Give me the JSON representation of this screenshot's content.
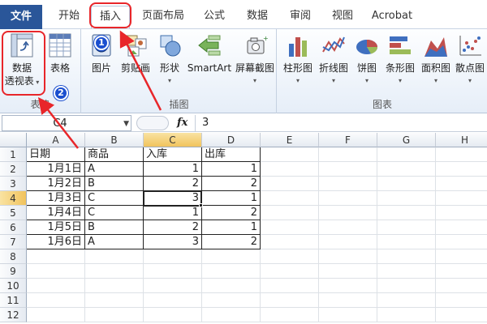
{
  "tabs": [
    {
      "label": "文件",
      "kind": "file"
    },
    {
      "label": "开始"
    },
    {
      "label": "插入",
      "active": true
    },
    {
      "label": "页面布局"
    },
    {
      "label": "公式"
    },
    {
      "label": "数据"
    },
    {
      "label": "审阅"
    },
    {
      "label": "视图"
    },
    {
      "label": "Acrobat"
    }
  ],
  "ribbon": {
    "tables_group": {
      "label": "表格",
      "pivot_line1": "数据",
      "pivot_line2": "透视表",
      "table": "表格"
    },
    "illustrations_group": {
      "label": "插图",
      "picture": "图片",
      "clipart": "剪贴画",
      "shapes": "形状",
      "smartart": "SmartArt",
      "screenshot": "屏幕截图"
    },
    "charts_group": {
      "label": "图表",
      "column": "柱形图",
      "line": "折线图",
      "pie": "饼图",
      "bar": "条形图",
      "area": "面积图",
      "scatter": "散点图"
    }
  },
  "formula_bar": {
    "name_box": "C4",
    "fx": "fx",
    "value": "3"
  },
  "sheet": {
    "columns": [
      "A",
      "B",
      "C",
      "D",
      "E",
      "F",
      "G",
      "H"
    ],
    "selected_column": "C",
    "selected_row": 4,
    "row_numbers": [
      "1",
      "2",
      "3",
      "4",
      "5",
      "6",
      "7",
      "8",
      "9",
      "10",
      "11",
      "12"
    ],
    "headers": [
      "日期",
      "商品",
      "入库",
      "出库"
    ],
    "rows": [
      [
        "1月1日",
        "A",
        "1",
        "1"
      ],
      [
        "1月2日",
        "B",
        "2",
        "2"
      ],
      [
        "1月3日",
        "C",
        "3",
        "1"
      ],
      [
        "1月4日",
        "C",
        "1",
        "2"
      ],
      [
        "1月5日",
        "B",
        "2",
        "1"
      ],
      [
        "1月6日",
        "A",
        "3",
        "2"
      ]
    ]
  },
  "annotations": {
    "step1": "1",
    "step2": "2"
  },
  "colors": {
    "file_tab": "#2a5699",
    "annotation_red": "#e8262a",
    "badge_blue": "#1b4fcf",
    "selection_header": "#f1c35d"
  }
}
